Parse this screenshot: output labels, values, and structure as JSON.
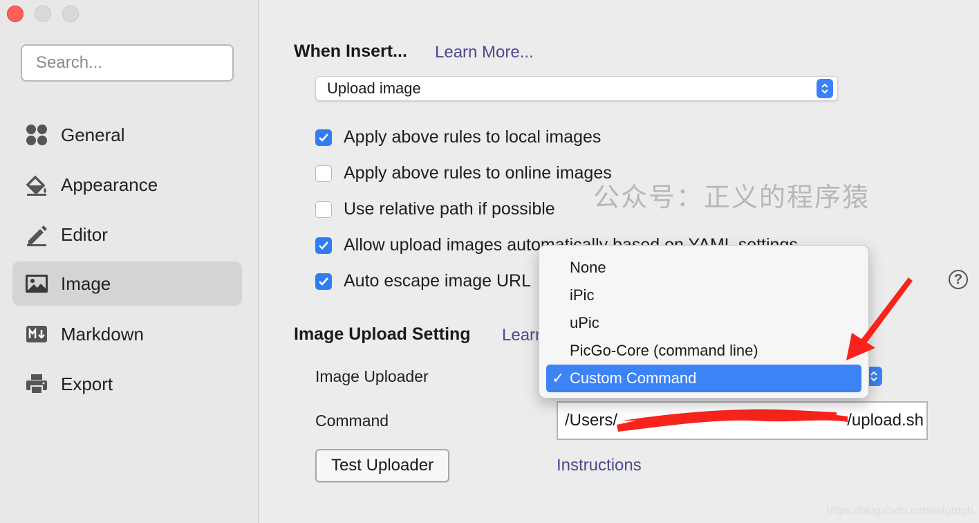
{
  "window": {
    "traffic_lights": [
      "close",
      "minimize",
      "maximize"
    ]
  },
  "sidebar": {
    "search_placeholder": "Search...",
    "items": [
      {
        "label": "General",
        "icon": "general-icon"
      },
      {
        "label": "Appearance",
        "icon": "appearance-icon"
      },
      {
        "label": "Editor",
        "icon": "editor-icon"
      },
      {
        "label": "Image",
        "icon": "image-icon",
        "active": true
      },
      {
        "label": "Markdown",
        "icon": "markdown-icon"
      },
      {
        "label": "Export",
        "icon": "export-icon"
      }
    ]
  },
  "insert": {
    "title": "When Insert...",
    "learn_more": "Learn More...",
    "select_value": "Upload image",
    "options": [
      {
        "label": "Apply above rules to local images",
        "checked": true
      },
      {
        "label": "Apply above rules to online images",
        "checked": false
      },
      {
        "label": "Use relative path if possible",
        "checked": false
      },
      {
        "label": "Allow upload images automatically based on YAML settings",
        "checked": true
      },
      {
        "label": "Auto escape image URL",
        "checked": true
      }
    ],
    "help_label": "?"
  },
  "upload": {
    "title": "Image Upload Setting",
    "learn_more": "Learn",
    "uploader_label": "Image Uploader",
    "command_label": "Command",
    "command_value": "/Users/",
    "command_value_end": "/upload.sh",
    "test_button": "Test Uploader",
    "instructions": "Instructions"
  },
  "uploader_menu": {
    "items": [
      "None",
      "iPic",
      "uPic",
      "PicGo-Core (command line)",
      "Custom Command"
    ],
    "selected": "Custom Command",
    "check_glyph": "✓"
  },
  "watermark": "公众号：正义的程序猿",
  "credit": "https://blog.csdn.net/wsfgrdgh",
  "colors": {
    "accent": "#3c83f6",
    "link": "#4a4a8f",
    "annotation_red": "#f8241c"
  }
}
